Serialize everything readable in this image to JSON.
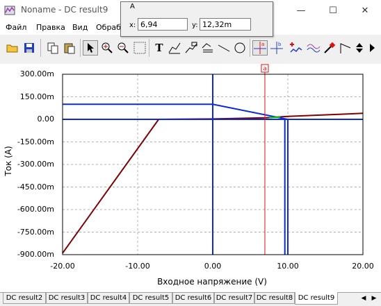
{
  "window": {
    "title": "Noname - DC result9",
    "minimize_glyph": "—",
    "maximize_glyph": "☐",
    "close_glyph": "✕"
  },
  "menu": [
    "Файл",
    "Правка",
    "Вид",
    "Обраб"
  ],
  "popup": {
    "caption": "A",
    "x_label": "x:",
    "x_value": "6,94",
    "y_label": "y:",
    "y_value": "12,32m"
  },
  "toolbar": {
    "icons": [
      "open-folder-icon",
      "save-icon",
      "copy-icon",
      "paste-icon",
      "pointer-icon",
      "zoom-in-icon",
      "zoom-out-icon",
      "zoom-100-icon",
      "text-tool-icon",
      "curve-tool-icon",
      "label-tool-icon",
      "multi-label-icon",
      "line-tool-icon",
      "circle-tool-icon",
      "cursor-a-icon",
      "cursor-b-icon",
      "add-curve-icon",
      "wave-icon",
      "probe-icon",
      "flag-icon",
      "arrow-up-icon",
      "arrow-down-icon"
    ],
    "zoom100_text": "100%",
    "text_tool_glyph": "T"
  },
  "colors": {
    "cursor": "#e01010",
    "trace_blue": "#0a28e0",
    "trace_darkred": "#800000",
    "grid": "#b0b0b0",
    "green_marker": "#00c000"
  },
  "chart_data": {
    "type": "line",
    "xlabel": "Входное напряжение (V)",
    "ylabel": "Ток (A)",
    "xlim": [
      -20,
      20
    ],
    "ylim": [
      -900,
      300
    ],
    "y_unit": "m",
    "x_ticks": [
      "-20.00",
      "-10.00",
      "0.00",
      "10.00",
      "20.00"
    ],
    "y_ticks": [
      "300.00m",
      "150.00m",
      "0.00",
      "-150.00m",
      "-300.00m",
      "-450.00m",
      "-600.00m",
      "-750.00m",
      "-900.00m"
    ],
    "cursor": {
      "label": "a",
      "x": 6.94,
      "y": 12.32
    },
    "series": [
      {
        "color": "#800000",
        "points": [
          [
            -20,
            -890
          ],
          [
            -7.2,
            0
          ],
          [
            0,
            3
          ],
          [
            7,
            10
          ],
          [
            10,
            20
          ],
          [
            20,
            40
          ]
        ]
      },
      {
        "color": "#0a28e0",
        "points": [
          [
            -20,
            100
          ],
          [
            0,
            100
          ],
          [
            8.5,
            15
          ],
          [
            10,
            0
          ],
          [
            20,
            0
          ]
        ]
      },
      {
        "color": "#0a28e0",
        "points": [
          [
            -20,
            0
          ],
          [
            0,
            0
          ],
          [
            10,
            0
          ],
          [
            20,
            0
          ]
        ]
      },
      {
        "color": "#0a28e0",
        "points": [
          [
            0,
            300
          ],
          [
            0,
            -900
          ]
        ]
      },
      {
        "color": "#0a28e0",
        "points": [
          [
            10,
            0
          ],
          [
            10,
            -900
          ]
        ]
      },
      {
        "color": "#0a28e0",
        "points": [
          [
            9.6,
            0
          ],
          [
            9.6,
            -900
          ]
        ]
      }
    ]
  },
  "tabs": [
    "DC result2",
    "DC result3",
    "DC result4",
    "DC result5",
    "DC result6",
    "DC result7",
    "DC result8",
    "DC result9"
  ],
  "active_tab": "DC result9",
  "tab_nav": {
    "prev": "◀",
    "next": "▶"
  }
}
